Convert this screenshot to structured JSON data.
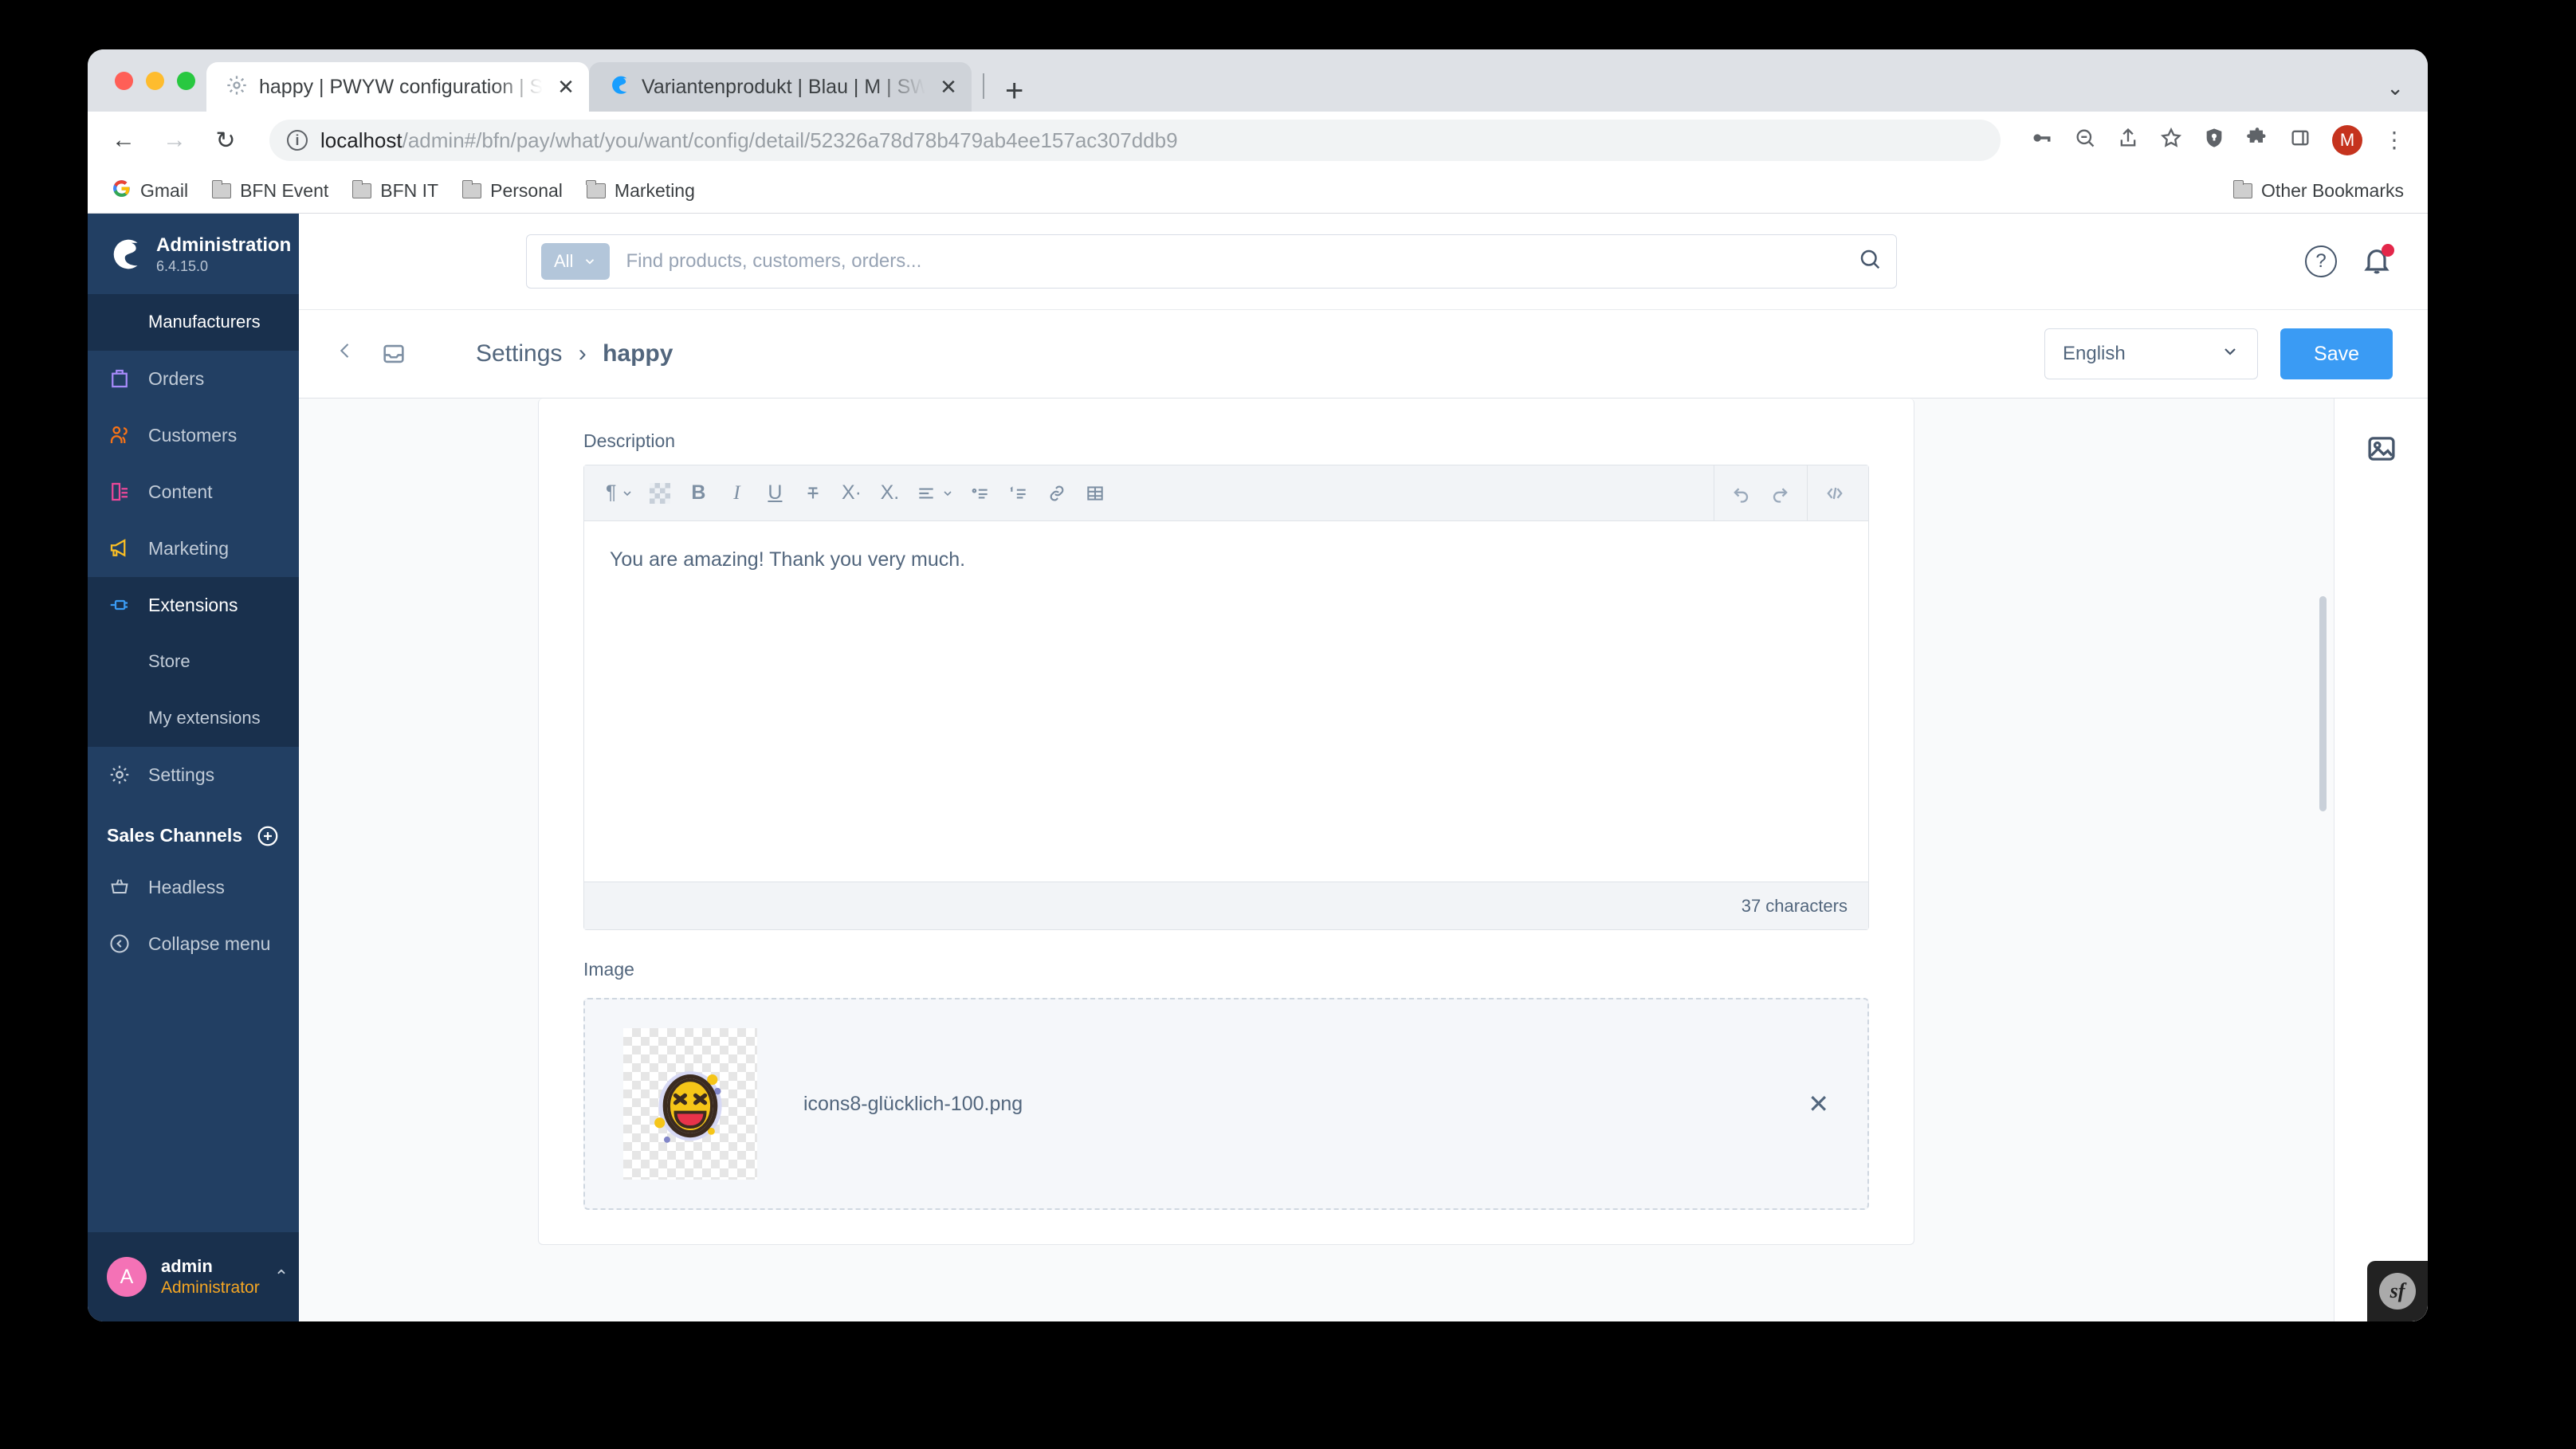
{
  "browser": {
    "tabs": [
      {
        "title": "happy | PWYW configuration | S",
        "favicon": "gear-icon",
        "active": true
      },
      {
        "title": "Variantenprodukt | Blau | M | SW",
        "favicon": "shopware-icon",
        "active": false
      }
    ],
    "new_tab_label": "+",
    "close_label": "✕",
    "tabstrip_menu": "⌄",
    "nav": {
      "back": "←",
      "forward": "→",
      "reload": "↻"
    },
    "url": {
      "host": "localhost",
      "path": "/admin#/bfn/pay/what/you/want/config/detail/52326a78d78b479ab4ee157ac307ddb9"
    },
    "toolbar_icons": [
      "key-icon",
      "zoom-out-icon",
      "share-icon",
      "bookmark-star-icon",
      "shield-icon",
      "extensions-puzzle-icon",
      "side-panel-icon"
    ],
    "profile_initial": "M",
    "menu_label": "⋮",
    "bookmarks": [
      {
        "label": "Gmail",
        "icon": "gmail-icon"
      },
      {
        "label": "BFN Event",
        "icon": "folder-icon"
      },
      {
        "label": "BFN IT",
        "icon": "folder-icon"
      },
      {
        "label": "Personal",
        "icon": "folder-icon"
      },
      {
        "label": "Marketing",
        "icon": "folder-icon"
      }
    ],
    "other_bookmarks": "Other Bookmarks"
  },
  "sidebar": {
    "app_title": "Administration",
    "version": "6.4.15.0",
    "items": [
      {
        "label": "Manufacturers",
        "type": "sub",
        "active": true
      },
      {
        "label": "Orders",
        "icon": "bag-icon",
        "color": "#a78bfa"
      },
      {
        "label": "Customers",
        "icon": "people-icon",
        "color": "#f97316"
      },
      {
        "label": "Content",
        "icon": "content-icon",
        "color": "#ec4899"
      },
      {
        "label": "Marketing",
        "icon": "megaphone-icon",
        "color": "#fbbf24"
      },
      {
        "label": "Extensions",
        "icon": "plug-icon",
        "color": "#3a9bf4",
        "active": true
      },
      {
        "label": "Store",
        "type": "sub"
      },
      {
        "label": "My extensions",
        "type": "sub"
      },
      {
        "label": "Settings",
        "icon": "gear-icon",
        "color": "#c2ccd8"
      }
    ],
    "sales_channels": {
      "title": "Sales Channels",
      "add_label": "+",
      "items": [
        {
          "label": "Headless",
          "icon": "basket-icon"
        },
        {
          "label": "Collapse menu",
          "icon": "collapse-icon"
        }
      ]
    },
    "user": {
      "initial": "A",
      "name": "admin",
      "role": "Administrator",
      "caret": "⌃"
    }
  },
  "topbar": {
    "search": {
      "scope": "All",
      "placeholder": "Find products, customers, orders...",
      "icon": "search-icon"
    },
    "help_icon": "?",
    "notifications_icon": "bell-icon"
  },
  "header": {
    "back_icon": "chevron-left-icon",
    "tray_icon": "inbox-icon",
    "breadcrumb_root": "Settings",
    "breadcrumb_separator": "›",
    "breadcrumb_current": "happy",
    "language": "English",
    "language_caret": "⌄",
    "save_label": "Save"
  },
  "form": {
    "description_label": "Description",
    "editor_toolbar": [
      {
        "name": "paragraph-format",
        "glyph": "¶",
        "caret": true
      },
      {
        "name": "text-color-swatch",
        "glyph": ""
      },
      {
        "name": "bold",
        "glyph": "B"
      },
      {
        "name": "italic",
        "glyph": "I"
      },
      {
        "name": "underline",
        "glyph": "U"
      },
      {
        "name": "strikethrough",
        "glyph": "T̶"
      },
      {
        "name": "superscript",
        "glyph": "X·"
      },
      {
        "name": "subscript",
        "glyph": "X."
      },
      {
        "name": "align",
        "glyph": "≡",
        "caret": true
      },
      {
        "name": "bullet-list",
        "glyph": "≣"
      },
      {
        "name": "ordered-list",
        "glyph": "1≡"
      },
      {
        "name": "link",
        "glyph": "⚭"
      },
      {
        "name": "table",
        "glyph": "⊞"
      }
    ],
    "editor_toolbar_right": [
      {
        "name": "undo",
        "glyph": "↩"
      },
      {
        "name": "redo",
        "glyph": "↪"
      },
      {
        "name": "code-view",
        "glyph": "‹/›"
      }
    ],
    "editor_content": "You are amazing! Thank you very much.",
    "character_count": "37 characters",
    "image_label": "Image",
    "image_filename": "icons8-glücklich-100.png",
    "remove_label": "✕"
  },
  "rail": {
    "media_icon": "image-icon"
  },
  "debug": {
    "symfony_label": "sf"
  }
}
